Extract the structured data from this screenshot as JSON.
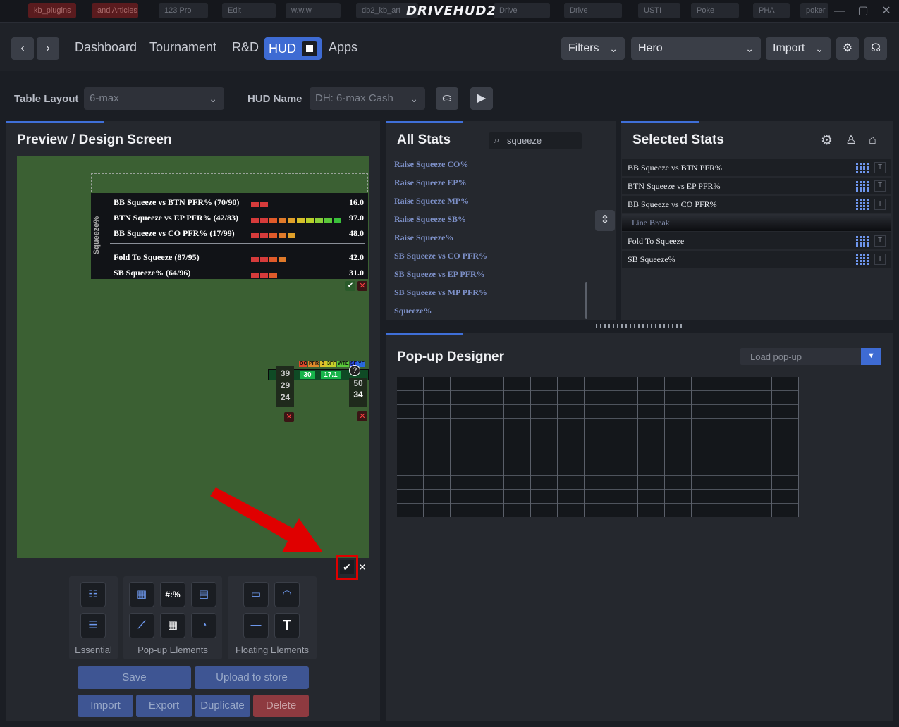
{
  "browser": {
    "tabs": [
      {
        "label": "kb_plugins",
        "red": true
      },
      {
        "label": "and Articles",
        "red": true
      },
      {
        "label": "123 Pro"
      },
      {
        "label": "Edit"
      },
      {
        "label": "w.w.w"
      },
      {
        "label": "db2_kb_art"
      },
      {
        "label": "Drive"
      },
      {
        "label": "Drive"
      },
      {
        "label": "USTI"
      },
      {
        "label": "Poke"
      },
      {
        "label": "PHA"
      },
      {
        "label": "poker"
      }
    ]
  },
  "app": {
    "logo": "DRIVEHUD2",
    "win_min": "—",
    "win_max": "▢",
    "win_close": "✕"
  },
  "nav": {
    "back": "‹",
    "forward": "›",
    "links": [
      "Dashboard",
      "Tournament",
      "R&D",
      "HUD",
      "Apps"
    ],
    "filters_label": "Filters",
    "player_value": "Hero",
    "import_label": "Import",
    "settings_icon": "⚙",
    "support_icon": "☊"
  },
  "toolbar": {
    "table_layout_label": "Table Layout",
    "table_layout_value": "6-max",
    "hud_name_label": "HUD Name",
    "hud_name_value": "DH: 6-max Cash"
  },
  "preview": {
    "title": "Preview / Design Screen",
    "hud_vertical_label": "Squeeze%",
    "rows": [
      {
        "name": "BB Squeeze vs BTN PFR% (70/90)",
        "value": "16.0",
        "segments": 2
      },
      {
        "name": "BTN Squeeze vs EP PFR% (42/83)",
        "value": "97.0",
        "segments": 10
      },
      {
        "name": "BB Squeeze vs CO PFR% (17/99)",
        "value": "48.0",
        "segments": 5
      },
      {
        "name": "Fold To Squeeze (87/95)",
        "value": "42.0",
        "segments": 4
      },
      {
        "name": "SB Squeeze% (64/96)",
        "value": "31.0",
        "segments": 3
      }
    ],
    "player_hud": {
      "tags": [
        "OO",
        "PFR",
        "3",
        "3FF",
        "WTE",
        "SF",
        "YF"
      ],
      "values": [
        "30",
        "17.1"
      ],
      "left_stack": [
        "39",
        "29",
        "24"
      ],
      "right_stack": [
        "50",
        "34"
      ],
      "help": "?"
    }
  },
  "tools": {
    "essential_label": "Essential",
    "popup_label": "Pop-up Elements",
    "floating_label": "Floating Elements",
    "popup_text_icon": "#:%",
    "text_tool_icon": "T"
  },
  "actions": {
    "save": "Save",
    "upload": "Upload to store",
    "import": "Import",
    "export": "Export",
    "duplicate": "Duplicate",
    "delete": "Delete"
  },
  "all_stats": {
    "title": "All Stats",
    "search_value": "squeeze",
    "items": [
      "Raise Squeeze CO%",
      "Raise Squeeze EP%",
      "Raise Squeeze MP%",
      "Raise Squeeze SB%",
      "Raise Squeeze%",
      "SB Squeeze vs CO PFR%",
      "SB Squeeze vs EP PFR%",
      "SB Squeeze vs MP PFR%",
      "Squeeze%"
    ]
  },
  "selected_stats": {
    "title": "Selected Stats",
    "items": [
      {
        "name": "BB Squeeze vs BTN PFR%",
        "type": "stat"
      },
      {
        "name": "BTN Squeeze vs EP PFR%",
        "type": "stat"
      },
      {
        "name": "BB Squeeze vs CO PFR%",
        "type": "stat"
      },
      {
        "name": "Line Break",
        "type": "break"
      },
      {
        "name": "Fold To Squeeze",
        "type": "stat"
      },
      {
        "name": "SB Squeeze%",
        "type": "stat"
      }
    ],
    "t_label": "T"
  },
  "popup_designer": {
    "title": "Pop-up Designer",
    "load_label": "Load pop-up"
  },
  "colors": {
    "accent": "#3e6bd3",
    "felt": "#3b6033",
    "highlight": "#e00000"
  }
}
